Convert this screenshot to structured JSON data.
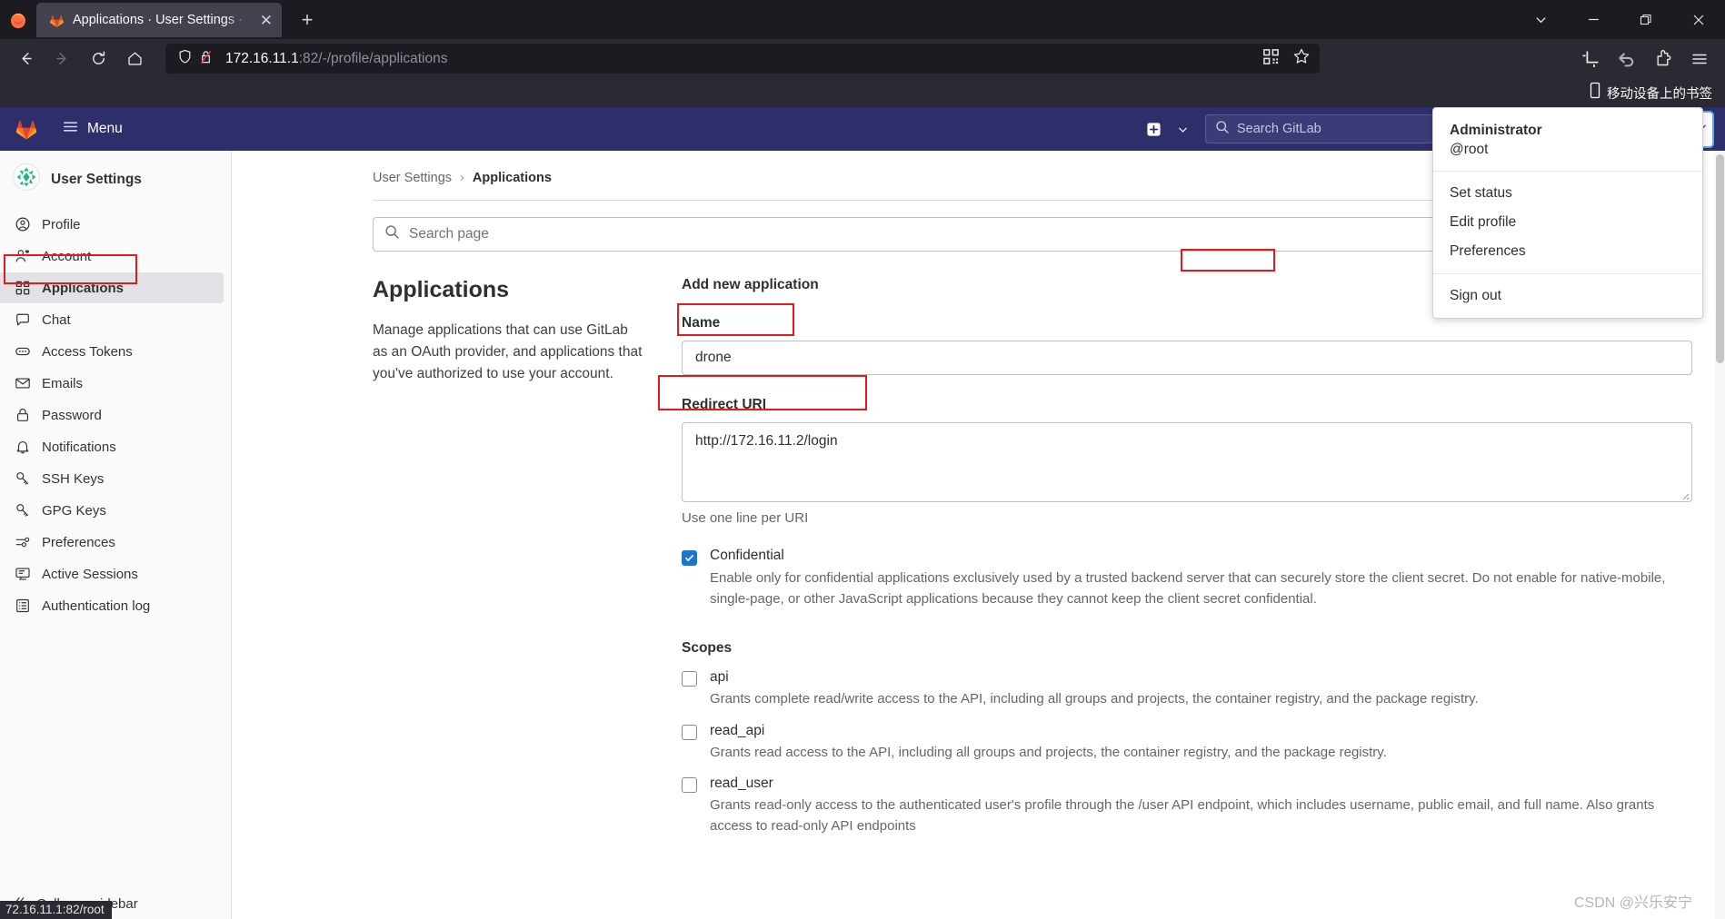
{
  "browser": {
    "tab": {
      "title": "Applications · User Settings ·",
      "close_label": "✕"
    },
    "newtab_label": "+",
    "window": {
      "minimize": "—",
      "restore": "❐",
      "close": "✕",
      "tablist_chevron": "⌄"
    },
    "url": {
      "host": "172.16.11.1",
      "path": ":82/-/profile/applications",
      "full": "172.16.11.1:82/-/profile/applications"
    },
    "bookmark": {
      "label": "移动设备上的书签",
      "icon": "mobile-device-icon"
    },
    "icons": {
      "back": "back-arrow-icon",
      "forward": "forward-arrow-icon",
      "reload": "reload-icon",
      "home": "home-icon",
      "shield": "tracking-protection-shield-icon",
      "lock_broken": "insecure-connection-icon",
      "qr": "qr-code-icon",
      "star": "bookmark-star-icon",
      "screenshot": "screenshot-icon",
      "undo": "undo-icon",
      "extension": "extension-icon",
      "appmenu": "hamburger-menu-icon"
    }
  },
  "gitlab_nav": {
    "menu_label": "Menu",
    "search_placeholder": "Search GitLab",
    "search_shortcut": "/",
    "icons": {
      "plus": "plus-square-icon",
      "chevron": "chevron-down-icon",
      "search": "search-icon",
      "issues": "issues-icon",
      "merge_requests": "merge-requests-icon",
      "todos": "todos-checkbox-icon",
      "help": "help-question-icon",
      "avatar": "user-avatar"
    }
  },
  "sidebar": {
    "header": "User Settings",
    "items": [
      {
        "label": "Profile",
        "icon": "user-circle-icon",
        "active": false
      },
      {
        "label": "Account",
        "icon": "account-gear-icon",
        "active": false
      },
      {
        "label": "Applications",
        "icon": "applications-grid-icon",
        "active": true
      },
      {
        "label": "Chat",
        "icon": "chat-bubble-icon",
        "active": false
      },
      {
        "label": "Access Tokens",
        "icon": "token-icon",
        "active": false
      },
      {
        "label": "Emails",
        "icon": "envelope-icon",
        "active": false
      },
      {
        "label": "Password",
        "icon": "lock-icon",
        "active": false
      },
      {
        "label": "Notifications",
        "icon": "bell-icon",
        "active": false
      },
      {
        "label": "SSH Keys",
        "icon": "key-icon",
        "active": false
      },
      {
        "label": "GPG Keys",
        "icon": "key-icon",
        "active": false
      },
      {
        "label": "Preferences",
        "icon": "sliders-icon",
        "active": false
      },
      {
        "label": "Active Sessions",
        "icon": "monitor-icon",
        "active": false
      },
      {
        "label": "Authentication log",
        "icon": "log-list-icon",
        "active": false
      }
    ],
    "collapse_label": "Collapse sidebar"
  },
  "status_bar": {
    "text": "72.16.11.1:82/root"
  },
  "breadcrumb": {
    "parent": "User Settings",
    "separator": "›",
    "current": "Applications"
  },
  "page_search": {
    "placeholder": "Search page"
  },
  "main": {
    "heading": "Applications",
    "description": "Manage applications that can use GitLab as an OAuth provider, and applications that you've authorized to use your account."
  },
  "form": {
    "title": "Add new application",
    "name_label": "Name",
    "name_value": "drone",
    "redirect_label": "Redirect URI",
    "redirect_value": "http://172.16.11.2/login",
    "redirect_help": "Use one line per URI",
    "confidential": {
      "label": "Confidential",
      "checked": true,
      "description": "Enable only for confidential applications exclusively used by a trusted backend server that can securely store the client secret. Do not enable for native-mobile, single-page, or other JavaScript applications because they cannot keep the client secret confidential."
    },
    "scopes_label": "Scopes",
    "scopes": [
      {
        "name": "api",
        "checked": false,
        "description": "Grants complete read/write access to the API, including all groups and projects, the container registry, and the package registry."
      },
      {
        "name": "read_api",
        "checked": false,
        "description": "Grants read access to the API, including all groups and projects, the container registry, and the package registry."
      },
      {
        "name": "read_user",
        "checked": false,
        "description": "Grants read-only access to the authenticated user's profile through the /user API endpoint, which includes username, public email, and full name. Also grants access to read-only API endpoints"
      }
    ]
  },
  "user_menu": {
    "name": "Administrator",
    "handle": "@root",
    "items": [
      {
        "label": "Set status",
        "highlighted": false
      },
      {
        "label": "Edit profile",
        "highlighted": true
      },
      {
        "label": "Preferences",
        "highlighted": false
      },
      {
        "label": "Sign out",
        "highlighted": false
      }
    ]
  },
  "watermark": {
    "text": "CSDN @兴乐安宁"
  },
  "colors": {
    "gitlab_navy": "#2e2e6b",
    "accent_blue": "#1f75cb",
    "annotation_red": "#e31b1b",
    "chrome_dark": "#2b2a33",
    "tabstrip_dark": "#1c1b22"
  }
}
